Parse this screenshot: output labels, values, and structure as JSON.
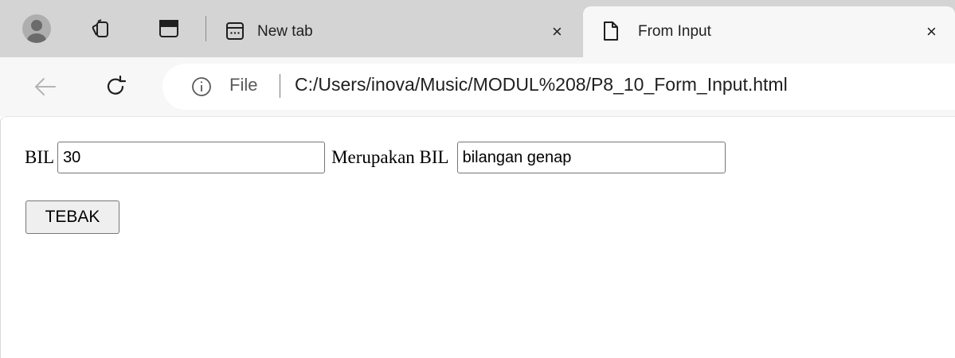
{
  "browser": {
    "tabs": [
      {
        "title": "New tab",
        "icon": "terminal-icon",
        "active": false
      },
      {
        "title": "From Input",
        "icon": "page-icon",
        "active": true
      }
    ],
    "close_glyph": "×",
    "address": {
      "info_label": "File",
      "url": "C:/Users/inova/Music/MODUL%208/P8_10_Form_Input.html"
    }
  },
  "form": {
    "number_label": "BIL",
    "number_value": "30",
    "result_label": "Merupakan BIL",
    "result_value": "bilangan genap",
    "button_label": "TEBAK"
  }
}
